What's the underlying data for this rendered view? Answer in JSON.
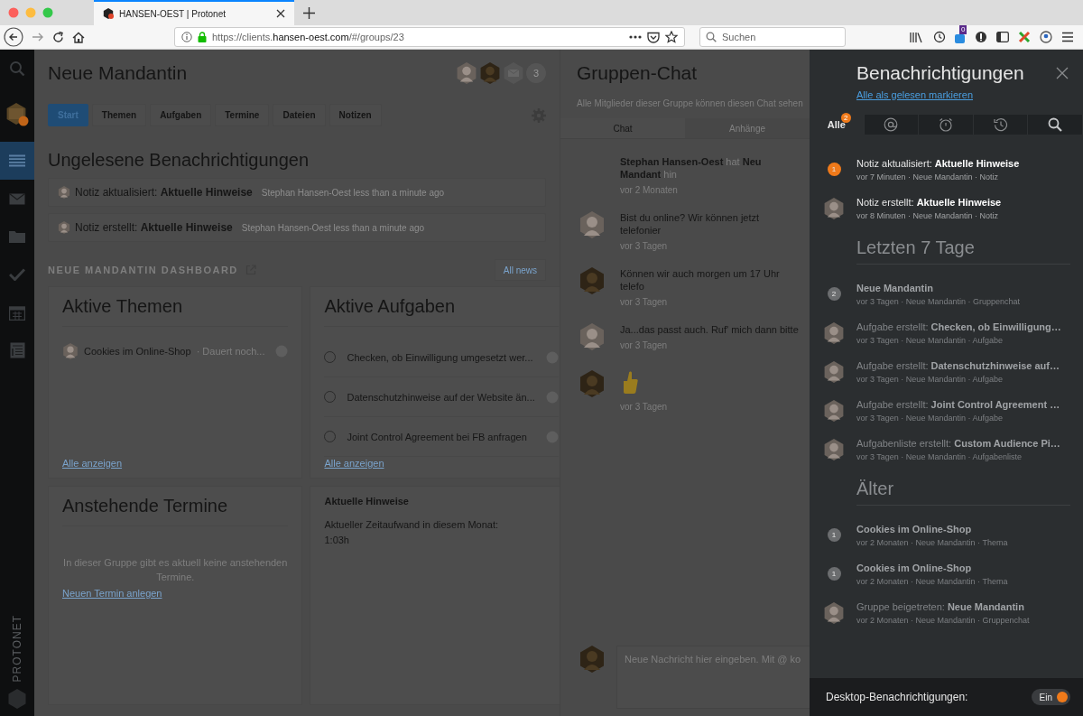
{
  "browser": {
    "tab_title": "HANSEN-OEST | Protonet",
    "url_prefix": "https://clients.",
    "url_host": "hansen-oest.com",
    "url_path": "/#/groups/23",
    "search_placeholder": "Suchen",
    "extension_badge": "0"
  },
  "sidebar": {
    "items": [
      {
        "kind": "search",
        "selected": false
      },
      {
        "kind": "group",
        "selected": false
      },
      {
        "kind": "stream",
        "selected": true
      },
      {
        "kind": "mail",
        "selected": false
      },
      {
        "kind": "files",
        "selected": false
      },
      {
        "kind": "tasks",
        "selected": false
      },
      {
        "kind": "calendar",
        "selected": false
      },
      {
        "kind": "notes",
        "selected": false
      }
    ],
    "brand": "PROTONET"
  },
  "group": {
    "title": "Neue Mandantin",
    "members": [
      {
        "kind": "person"
      },
      {
        "kind": "person"
      },
      {
        "kind": "mail"
      }
    ],
    "member_count": "3",
    "tabs": [
      {
        "label": "Start",
        "selected": true
      },
      {
        "label": "Themen",
        "selected": false
      },
      {
        "label": "Aufgaben",
        "selected": false
      },
      {
        "label": "Termine",
        "selected": false
      },
      {
        "label": "Dateien",
        "selected": false
      },
      {
        "label": "Notizen",
        "selected": false
      }
    ]
  },
  "unread": {
    "heading": "Ungelesene Benachrichtigungen",
    "items": [
      {
        "text": "Notiz aktualisiert: **Aktuelle Hinweise**",
        "meta": "Stephan Hansen-Oest less than a minute ago"
      },
      {
        "text": "Notiz erstellt: **Aktuelle Hinweise**",
        "meta": "Stephan Hansen-Oest less than a minute ago"
      }
    ]
  },
  "dashboard": {
    "title": "NEUE MANDANTIN DASHBOARD",
    "button": "All news",
    "themes": {
      "title": "Aktive Themen",
      "items": [
        {
          "text": "Cookies im Online-Shop",
          "extra": "· Dauert noch..."
        }
      ],
      "link": "Alle anzeigen"
    },
    "tasks": {
      "title": "Aktive Aufgaben",
      "items": [
        {
          "text": "Checken, ob Einwilligung umgesetzt wer...",
          "checked": false
        },
        {
          "text": "Datenschutzhinweise auf der Website än...",
          "checked": false
        },
        {
          "text": "Joint Control Agreement bei FB anfragen",
          "checked": false
        }
      ],
      "link": "Alle anzeigen"
    },
    "appointments": {
      "title": "Anstehende Termine",
      "empty": "In dieser Gruppe gibt es aktuell keine anstehenden Termine.",
      "link": "Neuen Termin anlegen"
    },
    "note": {
      "title": "Aktuelle Hinweise",
      "lines": [
        "Aktueller Zeitaufwand in diesem Monat:",
        "1:03h"
      ]
    }
  },
  "chat": {
    "title": "Gruppen-Chat",
    "subtitle": "Alle Mitglieder dieser Gruppe können diesen Chat sehen",
    "tabs": [
      {
        "label": "Chat",
        "selected": true
      },
      {
        "label": "Anhänge",
        "selected": false
      }
    ],
    "messages": [
      {
        "kind": "system",
        "text": "**Stephan Hansen-Oest** hat **Neu Mandant** hin",
        "time": "vor 2 Monaten"
      },
      {
        "kind": "text",
        "text": "Bist du online? Wir können jetzt telefonier",
        "time": "vor 3 Tagen"
      },
      {
        "kind": "text",
        "text": "Können wir auch morgen um 17 Uhr telefo",
        "time": "vor 3 Tagen"
      },
      {
        "kind": "text",
        "text": "Ja...das passt auch. Ruf' mich dann bitte",
        "time": "vor 3 Tagen"
      },
      {
        "kind": "thumbs",
        "time": "vor 3 Tagen"
      }
    ],
    "composer_placeholder": "Neue Nachricht hier eingeben. Mit @ ko"
  },
  "notifications": {
    "title": "Benachrichtigungen",
    "mark_read": "Alle als gelesen markieren",
    "tabs": [
      {
        "kind": "all",
        "label": "Alle",
        "badge": "2",
        "selected": true
      },
      {
        "kind": "mention",
        "selected": false
      },
      {
        "kind": "alarm",
        "selected": false
      },
      {
        "kind": "history",
        "selected": false
      },
      {
        "kind": "search",
        "selected": false
      }
    ],
    "sections": [
      {
        "items": [
          {
            "kind": "dot",
            "badge": "1",
            "color": "#f07a1a",
            "unread": true,
            "title": "Notiz aktualisiert: **Aktuelle Hinweise**",
            "meta": "vor 7 Minuten · Neue Mandantin · Notiz"
          },
          {
            "kind": "avatar",
            "unread": true,
            "title": "Notiz erstellt: **Aktuelle Hinweise**",
            "meta": "vor 8 Minuten · Neue Mandantin · Notiz"
          }
        ]
      },
      {
        "heading": "Letzten 7 Tage",
        "items": [
          {
            "kind": "dot",
            "badge": "2",
            "color": "#6b6d6f",
            "unread": false,
            "title": "**Neue Mandantin**",
            "meta": "vor 3 Tagen · Neue Mandantin · Gruppenchat"
          },
          {
            "kind": "avatar",
            "unread": false,
            "title": "Aufgabe erstellt: **Checken, ob Einwilligung…**",
            "meta": "vor 3 Tagen · Neue Mandantin · Aufgabe"
          },
          {
            "kind": "avatar",
            "unread": false,
            "title": "Aufgabe erstellt: **Datenschutzhinweise auf…**",
            "meta": "vor 3 Tagen · Neue Mandantin · Aufgabe"
          },
          {
            "kind": "avatar",
            "unread": false,
            "title": "Aufgabe erstellt: **Joint Control Agreement …**",
            "meta": "vor 3 Tagen · Neue Mandantin · Aufgabe"
          },
          {
            "kind": "avatar",
            "unread": false,
            "title": "Aufgabenliste erstellt: **Custom Audience Pi…**",
            "meta": "vor 3 Tagen · Neue Mandantin · Aufgabenliste"
          }
        ]
      },
      {
        "heading": "Älter",
        "items": [
          {
            "kind": "dot",
            "badge": "1",
            "color": "#6b6d6f",
            "unread": false,
            "title": "**Cookies im Online-Shop**",
            "meta": "vor 2 Monaten · Neue Mandantin · Thema"
          },
          {
            "kind": "dot",
            "badge": "1",
            "color": "#6b6d6f",
            "unread": false,
            "title": "**Cookies im Online-Shop**",
            "meta": "vor 2 Monaten · Neue Mandantin · Thema"
          },
          {
            "kind": "avatar",
            "unread": false,
            "title": "Gruppe beigetreten: **Neue Mandantin**",
            "meta": "vor 2 Monaten · Neue Mandantin · Gruppenchat"
          }
        ]
      }
    ],
    "footer": {
      "label": "Desktop-Benachrichtigungen:",
      "toggle": {
        "label": "Ein",
        "on": true
      }
    }
  }
}
